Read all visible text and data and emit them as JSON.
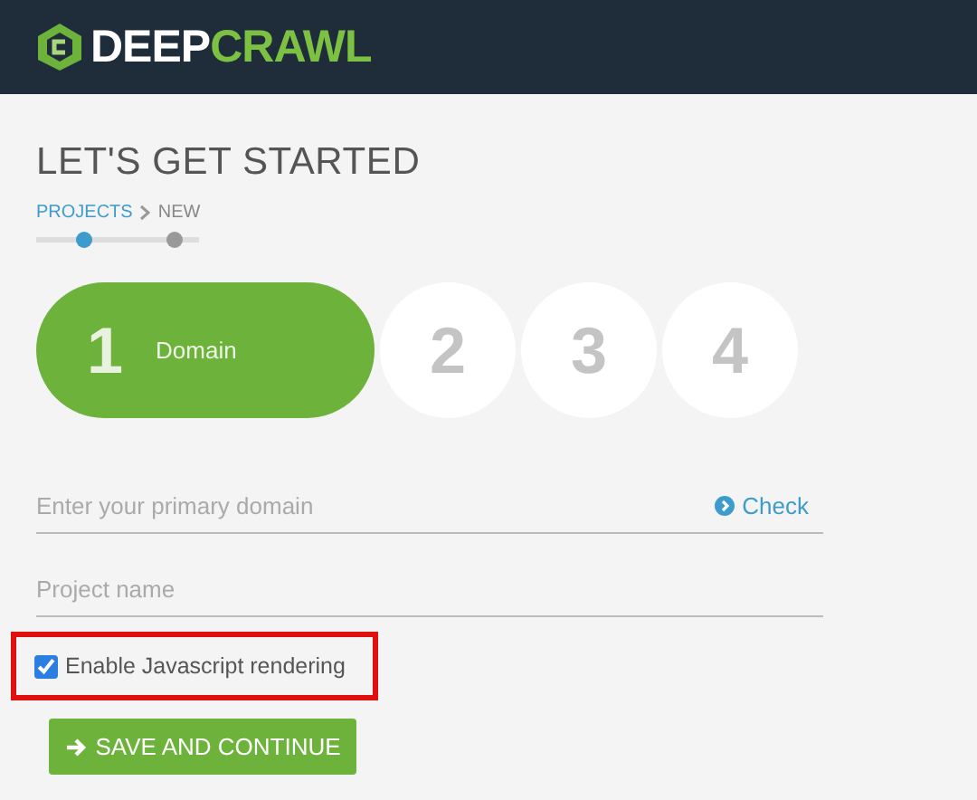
{
  "header": {
    "logo": {
      "part_1": "DEEP",
      "part_2": "CRAWL"
    }
  },
  "title": "LET'S GET STARTED",
  "breadcrumb": [
    {
      "label": "PROJECTS",
      "selected": true
    },
    {
      "label": "NEW",
      "selected": false
    }
  ],
  "steps": [
    {
      "number": "1",
      "label": "Domain",
      "selected": true
    },
    {
      "number": "2",
      "selected": false
    },
    {
      "number": "3",
      "selected": false
    },
    {
      "number": "4",
      "selected": false
    }
  ],
  "domain_field": {
    "placeholder": "Enter your primary domain",
    "action": "Check"
  },
  "project_field": {
    "placeholder": "Project name"
  },
  "javascript_option": {
    "label": "Enable Javascript rendering",
    "checked": true,
    "highlighted": true
  },
  "submit_button": "SAVE AND CONTINUE"
}
